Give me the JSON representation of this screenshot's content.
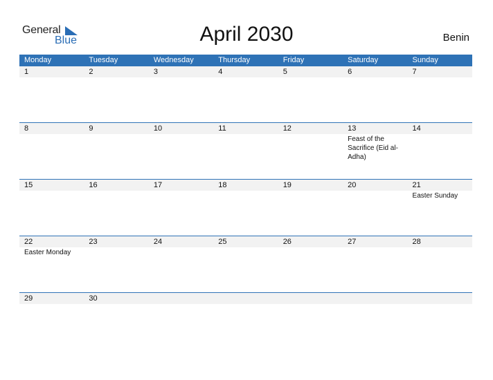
{
  "logo": {
    "part1": "General",
    "part2": "Blue"
  },
  "title": "April 2030",
  "country": "Benin",
  "colors": {
    "header_bg": "#2e72b6",
    "daynum_bg": "#f2f2f2"
  },
  "weekdays": [
    "Monday",
    "Tuesday",
    "Wednesday",
    "Thursday",
    "Friday",
    "Saturday",
    "Sunday"
  ],
  "weeks": [
    {
      "days": [
        "1",
        "2",
        "3",
        "4",
        "5",
        "6",
        "7"
      ],
      "events": [
        "",
        "",
        "",
        "",
        "",
        "",
        ""
      ]
    },
    {
      "days": [
        "8",
        "9",
        "10",
        "11",
        "12",
        "13",
        "14"
      ],
      "events": [
        "",
        "",
        "",
        "",
        "",
        "Feast of the Sacrifice (Eid al-Adha)",
        ""
      ]
    },
    {
      "days": [
        "15",
        "16",
        "17",
        "18",
        "19",
        "20",
        "21"
      ],
      "events": [
        "",
        "",
        "",
        "",
        "",
        "",
        "Easter Sunday"
      ]
    },
    {
      "days": [
        "22",
        "23",
        "24",
        "25",
        "26",
        "27",
        "28"
      ],
      "events": [
        "Easter Monday",
        "",
        "",
        "",
        "",
        "",
        ""
      ]
    },
    {
      "days": [
        "29",
        "30",
        "",
        "",
        "",
        "",
        ""
      ],
      "events": [
        "",
        "",
        "",
        "",
        "",
        "",
        ""
      ]
    }
  ]
}
